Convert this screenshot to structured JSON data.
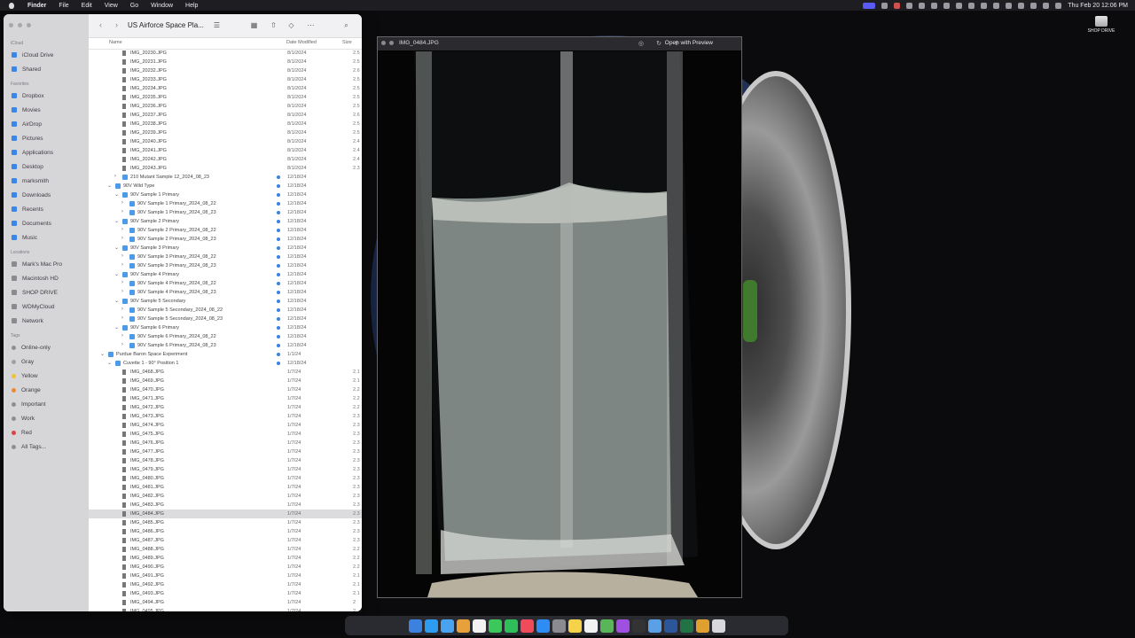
{
  "menubar": {
    "items": [
      "Finder",
      "File",
      "Edit",
      "View",
      "Go",
      "Window",
      "Help"
    ],
    "clock": "Thu Feb 20  12:06 PM"
  },
  "desktop": {
    "drive_label": "SHOP DRIVE"
  },
  "finder": {
    "title": "US Airforce Space Pla...",
    "columns": {
      "name": "Name",
      "date": "Date Modified",
      "size": "Size"
    },
    "sidebar": {
      "sections": [
        {
          "title": "iCloud",
          "items": [
            {
              "label": "iCloud Drive",
              "icon": "cloud-icon"
            },
            {
              "label": "Shared",
              "icon": "shared-folder-icon"
            }
          ]
        },
        {
          "title": "Favorites",
          "items": [
            {
              "label": "Dropbox",
              "icon": "dropbox-icon"
            },
            {
              "label": "Movies",
              "icon": "film-icon"
            },
            {
              "label": "AirDrop",
              "icon": "airdrop-icon"
            },
            {
              "label": "Pictures",
              "icon": "photo-icon"
            },
            {
              "label": "Applications",
              "icon": "applications-icon"
            },
            {
              "label": "Desktop",
              "icon": "desktop-icon"
            },
            {
              "label": "marksmith",
              "icon": "home-icon"
            },
            {
              "label": "Downloads",
              "icon": "download-icon"
            },
            {
              "label": "Recents",
              "icon": "clock-icon"
            },
            {
              "label": "Documents",
              "icon": "document-icon"
            },
            {
              "label": "Music",
              "icon": "music-icon"
            }
          ]
        },
        {
          "title": "Locations",
          "items": [
            {
              "label": "Mark's Mac Pro",
              "icon": "computer-icon"
            },
            {
              "label": "Macintosh HD",
              "icon": "disk-icon"
            },
            {
              "label": "SHOP DRIVE",
              "icon": "external-drive-icon"
            },
            {
              "label": "WDMyCloud",
              "icon": "network-drive-icon"
            },
            {
              "label": "Network",
              "icon": "network-icon"
            }
          ]
        },
        {
          "title": "Tags",
          "items": [
            {
              "label": "Online-only",
              "color": "#8e8e93"
            },
            {
              "label": "Gray",
              "color": "#a0a0a5"
            },
            {
              "label": "Yellow",
              "color": "#f2c12e"
            },
            {
              "label": "Orange",
              "color": "#f08a24"
            },
            {
              "label": "Important",
              "color": "#8e8e93"
            },
            {
              "label": "Work",
              "color": "#8e8e93"
            },
            {
              "label": "Red",
              "color": "#e0443e"
            },
            {
              "label": "All Tags...",
              "color": "#8e8e93"
            }
          ]
        }
      ]
    },
    "rows": [
      {
        "name": "IMG_20230.JPG",
        "date": "8/1/2024",
        "size": "2.5",
        "indent": 3,
        "type": "file"
      },
      {
        "name": "IMG_20231.JPG",
        "date": "8/1/2024",
        "size": "2.5",
        "indent": 3,
        "type": "file"
      },
      {
        "name": "IMG_20232.JPG",
        "date": "8/1/2024",
        "size": "2.6",
        "indent": 3,
        "type": "file"
      },
      {
        "name": "IMG_20233.JPG",
        "date": "8/1/2024",
        "size": "2.5",
        "indent": 3,
        "type": "file"
      },
      {
        "name": "IMG_20234.JPG",
        "date": "8/1/2024",
        "size": "2.5",
        "indent": 3,
        "type": "file"
      },
      {
        "name": "IMG_20235.JPG",
        "date": "8/1/2024",
        "size": "2.5",
        "indent": 3,
        "type": "file"
      },
      {
        "name": "IMG_20236.JPG",
        "date": "8/1/2024",
        "size": "2.5",
        "indent": 3,
        "type": "file"
      },
      {
        "name": "IMG_20237.JPG",
        "date": "8/1/2024",
        "size": "2.6",
        "indent": 3,
        "type": "file"
      },
      {
        "name": "IMG_20238.JPG",
        "date": "8/1/2024",
        "size": "2.5",
        "indent": 3,
        "type": "file"
      },
      {
        "name": "IMG_20239.JPG",
        "date": "8/1/2024",
        "size": "2.5",
        "indent": 3,
        "type": "file"
      },
      {
        "name": "IMG_20240.JPG",
        "date": "8/1/2024",
        "size": "2.4",
        "indent": 3,
        "type": "file"
      },
      {
        "name": "IMG_20241.JPG",
        "date": "8/1/2024",
        "size": "2.4",
        "indent": 3,
        "type": "file"
      },
      {
        "name": "IMG_20242.JPG",
        "date": "8/1/2024",
        "size": "2.4",
        "indent": 3,
        "type": "file"
      },
      {
        "name": "IMG_20243.JPG",
        "date": "8/1/2024",
        "size": "2.3",
        "indent": 3,
        "type": "file"
      },
      {
        "name": "210 Mutant Sample 12_2024_08_23",
        "date": "12/18/24",
        "size": "",
        "indent": 3,
        "type": "folder",
        "tri": "›",
        "tag": true
      },
      {
        "name": "90V Wild Type",
        "date": "12/18/24",
        "size": "",
        "indent": 2,
        "type": "folder",
        "tri": "⌄",
        "tag": true
      },
      {
        "name": "90V Sample 1 Primary",
        "date": "12/18/24",
        "size": "",
        "indent": 3,
        "type": "folder",
        "tri": "⌄",
        "tag": true
      },
      {
        "name": "90V Sample 1 Primary_2024_08_22",
        "date": "12/18/24",
        "size": "",
        "indent": 4,
        "type": "folder",
        "tri": "›",
        "tag": true
      },
      {
        "name": "90V Sample 1 Primary_2024_08_23",
        "date": "12/18/24",
        "size": "",
        "indent": 4,
        "type": "folder",
        "tri": "›",
        "tag": true
      },
      {
        "name": "90V Sample 2 Primary",
        "date": "12/18/24",
        "size": "",
        "indent": 3,
        "type": "folder",
        "tri": "⌄",
        "tag": true
      },
      {
        "name": "90V Sample 2 Primary_2024_08_22",
        "date": "12/18/24",
        "size": "",
        "indent": 4,
        "type": "folder",
        "tri": "›",
        "tag": true
      },
      {
        "name": "90V Sample 2 Primary_2024_08_23",
        "date": "12/18/24",
        "size": "",
        "indent": 4,
        "type": "folder",
        "tri": "›",
        "tag": true
      },
      {
        "name": "90V Sample 3 Primary",
        "date": "12/18/24",
        "size": "",
        "indent": 3,
        "type": "folder",
        "tri": "⌄",
        "tag": true
      },
      {
        "name": "90V Sample 3 Primary_2024_08_22",
        "date": "12/18/24",
        "size": "",
        "indent": 4,
        "type": "folder",
        "tri": "›",
        "tag": true
      },
      {
        "name": "90V Sample 3 Primary_2024_08_23",
        "date": "12/18/24",
        "size": "",
        "indent": 4,
        "type": "folder",
        "tri": "›",
        "tag": true
      },
      {
        "name": "90V Sample 4 Primary",
        "date": "12/18/24",
        "size": "",
        "indent": 3,
        "type": "folder",
        "tri": "⌄",
        "tag": true
      },
      {
        "name": "90V Sample 4 Primary_2024_08_22",
        "date": "12/18/24",
        "size": "",
        "indent": 4,
        "type": "folder",
        "tri": "›",
        "tag": true
      },
      {
        "name": "90V Sample 4 Primary_2024_08_23",
        "date": "12/18/24",
        "size": "",
        "indent": 4,
        "type": "folder",
        "tri": "›",
        "tag": true
      },
      {
        "name": "90V Sample 5 Secondary",
        "date": "12/18/24",
        "size": "",
        "indent": 3,
        "type": "folder",
        "tri": "⌄",
        "tag": true
      },
      {
        "name": "90V Sample 5 Secondary_2024_08_22",
        "date": "12/18/24",
        "size": "",
        "indent": 4,
        "type": "folder",
        "tri": "›",
        "tag": true
      },
      {
        "name": "90V Sample 5 Secondary_2024_08_23",
        "date": "12/18/24",
        "size": "",
        "indent": 4,
        "type": "folder",
        "tri": "›",
        "tag": true
      },
      {
        "name": "90V Sample 6 Primary",
        "date": "12/18/24",
        "size": "",
        "indent": 3,
        "type": "folder",
        "tri": "⌄",
        "tag": true
      },
      {
        "name": "90V Sample 6 Primary_2024_08_22",
        "date": "12/18/24",
        "size": "",
        "indent": 4,
        "type": "folder",
        "tri": "›",
        "tag": true
      },
      {
        "name": "90V Sample 6 Primary_2024_08_23",
        "date": "12/18/24",
        "size": "",
        "indent": 4,
        "type": "folder",
        "tri": "›",
        "tag": true
      },
      {
        "name": "Purdue Baron Space Experiment",
        "date": "1/1/24",
        "size": "",
        "indent": 1,
        "type": "folder",
        "tri": "⌄",
        "tag": true
      },
      {
        "name": "Cuvette 1 - 90° Position 1",
        "date": "12/18/24",
        "size": "",
        "indent": 2,
        "type": "folder",
        "tri": "⌄",
        "tag": true
      },
      {
        "name": "IMG_0468.JPG",
        "date": "1/7/24",
        "size": "2.1",
        "indent": 3,
        "type": "file"
      },
      {
        "name": "IMG_0469.JPG",
        "date": "1/7/24",
        "size": "2.1",
        "indent": 3,
        "type": "file"
      },
      {
        "name": "IMG_0470.JPG",
        "date": "1/7/24",
        "size": "2.2",
        "indent": 3,
        "type": "file"
      },
      {
        "name": "IMG_0471.JPG",
        "date": "1/7/24",
        "size": "2.2",
        "indent": 3,
        "type": "file"
      },
      {
        "name": "IMG_0472.JPG",
        "date": "1/7/24",
        "size": "2.2",
        "indent": 3,
        "type": "file"
      },
      {
        "name": "IMG_0473.JPG",
        "date": "1/7/24",
        "size": "2.3",
        "indent": 3,
        "type": "file"
      },
      {
        "name": "IMG_0474.JPG",
        "date": "1/7/24",
        "size": "2.3",
        "indent": 3,
        "type": "file"
      },
      {
        "name": "IMG_0475.JPG",
        "date": "1/7/24",
        "size": "2.3",
        "indent": 3,
        "type": "file"
      },
      {
        "name": "IMG_0476.JPG",
        "date": "1/7/24",
        "size": "2.3",
        "indent": 3,
        "type": "file"
      },
      {
        "name": "IMG_0477.JPG",
        "date": "1/7/24",
        "size": "2.3",
        "indent": 3,
        "type": "file"
      },
      {
        "name": "IMG_0478.JPG",
        "date": "1/7/24",
        "size": "2.3",
        "indent": 3,
        "type": "file"
      },
      {
        "name": "IMG_0479.JPG",
        "date": "1/7/24",
        "size": "2.3",
        "indent": 3,
        "type": "file"
      },
      {
        "name": "IMG_0480.JPG",
        "date": "1/7/24",
        "size": "2.3",
        "indent": 3,
        "type": "file"
      },
      {
        "name": "IMG_0481.JPG",
        "date": "1/7/24",
        "size": "2.3",
        "indent": 3,
        "type": "file"
      },
      {
        "name": "IMG_0482.JPG",
        "date": "1/7/24",
        "size": "2.3",
        "indent": 3,
        "type": "file"
      },
      {
        "name": "IMG_0483.JPG",
        "date": "1/7/24",
        "size": "2.3",
        "indent": 3,
        "type": "file"
      },
      {
        "name": "IMG_0484.JPG",
        "date": "1/7/24",
        "size": "2.3",
        "indent": 3,
        "type": "file",
        "selected": true
      },
      {
        "name": "IMG_0485.JPG",
        "date": "1/7/24",
        "size": "2.3",
        "indent": 3,
        "type": "file"
      },
      {
        "name": "IMG_0486.JPG",
        "date": "1/7/24",
        "size": "2.3",
        "indent": 3,
        "type": "file"
      },
      {
        "name": "IMG_0487.JPG",
        "date": "1/7/24",
        "size": "2.3",
        "indent": 3,
        "type": "file"
      },
      {
        "name": "IMG_0488.JPG",
        "date": "1/7/24",
        "size": "2.2",
        "indent": 3,
        "type": "file"
      },
      {
        "name": "IMG_0489.JPG",
        "date": "1/7/24",
        "size": "2.2",
        "indent": 3,
        "type": "file"
      },
      {
        "name": "IMG_0490.JPG",
        "date": "1/7/24",
        "size": "2.2",
        "indent": 3,
        "type": "file"
      },
      {
        "name": "IMG_0491.JPG",
        "date": "1/7/24",
        "size": "2.1",
        "indent": 3,
        "type": "file"
      },
      {
        "name": "IMG_0492.JPG",
        "date": "1/7/24",
        "size": "2.1",
        "indent": 3,
        "type": "file"
      },
      {
        "name": "IMG_0493.JPG",
        "date": "1/7/24",
        "size": "2.1",
        "indent": 3,
        "type": "file"
      },
      {
        "name": "IMG_0494.JPG",
        "date": "1/7/24",
        "size": "2",
        "indent": 3,
        "type": "file"
      },
      {
        "name": "IMG_0495.JPG",
        "date": "1/7/24",
        "size": "2",
        "indent": 3,
        "type": "file"
      }
    ]
  },
  "preview": {
    "title": "IMG_0484.JPG",
    "open_label": "Open with Preview"
  },
  "dock": {
    "apps": [
      "finder",
      "safari",
      "mail",
      "photos",
      "calendar",
      "messages",
      "facetime",
      "music",
      "app-store",
      "settings",
      "notes",
      "reminders",
      "maps",
      "podcasts",
      "terminal",
      "preview",
      "word",
      "excel",
      "chrome",
      "trash"
    ]
  }
}
